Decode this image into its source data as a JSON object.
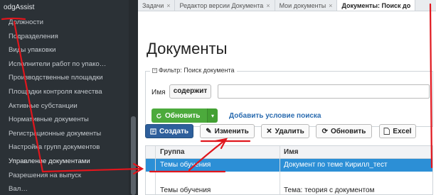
{
  "app": {
    "title": "odgAssist"
  },
  "sidebar": {
    "items": [
      {
        "label": "Должности"
      },
      {
        "label": "Подразделения"
      },
      {
        "label": "Виды упаковки"
      },
      {
        "label": "Исполнители работ по упако…"
      },
      {
        "label": "Производственные площадки"
      },
      {
        "label": "Площадки контроля качества"
      },
      {
        "label": "Активные субстанции"
      },
      {
        "label": "Нормативные документы"
      },
      {
        "label": "Регистрационные документы"
      },
      {
        "label": "Настройка групп документов"
      },
      {
        "label": "Управление документами"
      },
      {
        "label": "Разрешения на выпуск"
      },
      {
        "label": "Вал…"
      }
    ]
  },
  "tabs": [
    {
      "label": "Задачи",
      "close": "×"
    },
    {
      "label": "Редактор версии Документа",
      "close": "×"
    },
    {
      "label": "Мои документы",
      "close": "×"
    },
    {
      "label": "Документы: Поиск до"
    }
  ],
  "main": {
    "title": "Документы",
    "filter": {
      "legend": "Фильтр: Поиск документа",
      "field_label": "Имя",
      "operator": "содержит",
      "value": "",
      "refresh_label": "Обновить",
      "add_condition_label": "Добавить условие поиска"
    },
    "toolbar": {
      "create_label": "Создать",
      "edit_label": "Изменить",
      "delete_label": "Удалить",
      "refresh_label": "Обновить",
      "excel_label": "Excel"
    },
    "grid": {
      "columns": [
        "Группа",
        "Имя"
      ],
      "rows": [
        {
          "group": "Темы обучения",
          "name": "Документ по теме Кирилл_тест",
          "selected": true
        },
        {
          "group": "",
          "name": ""
        },
        {
          "group": "Темы обучения",
          "name": "Тема: теория с документом"
        }
      ]
    }
  },
  "colors": {
    "sidebar_bg": "#2b3136",
    "accent_blue": "#2e5f9c",
    "selection_blue": "#2c8fd6",
    "success_green": "#4caa3c",
    "annotation_red": "#e0161d"
  }
}
